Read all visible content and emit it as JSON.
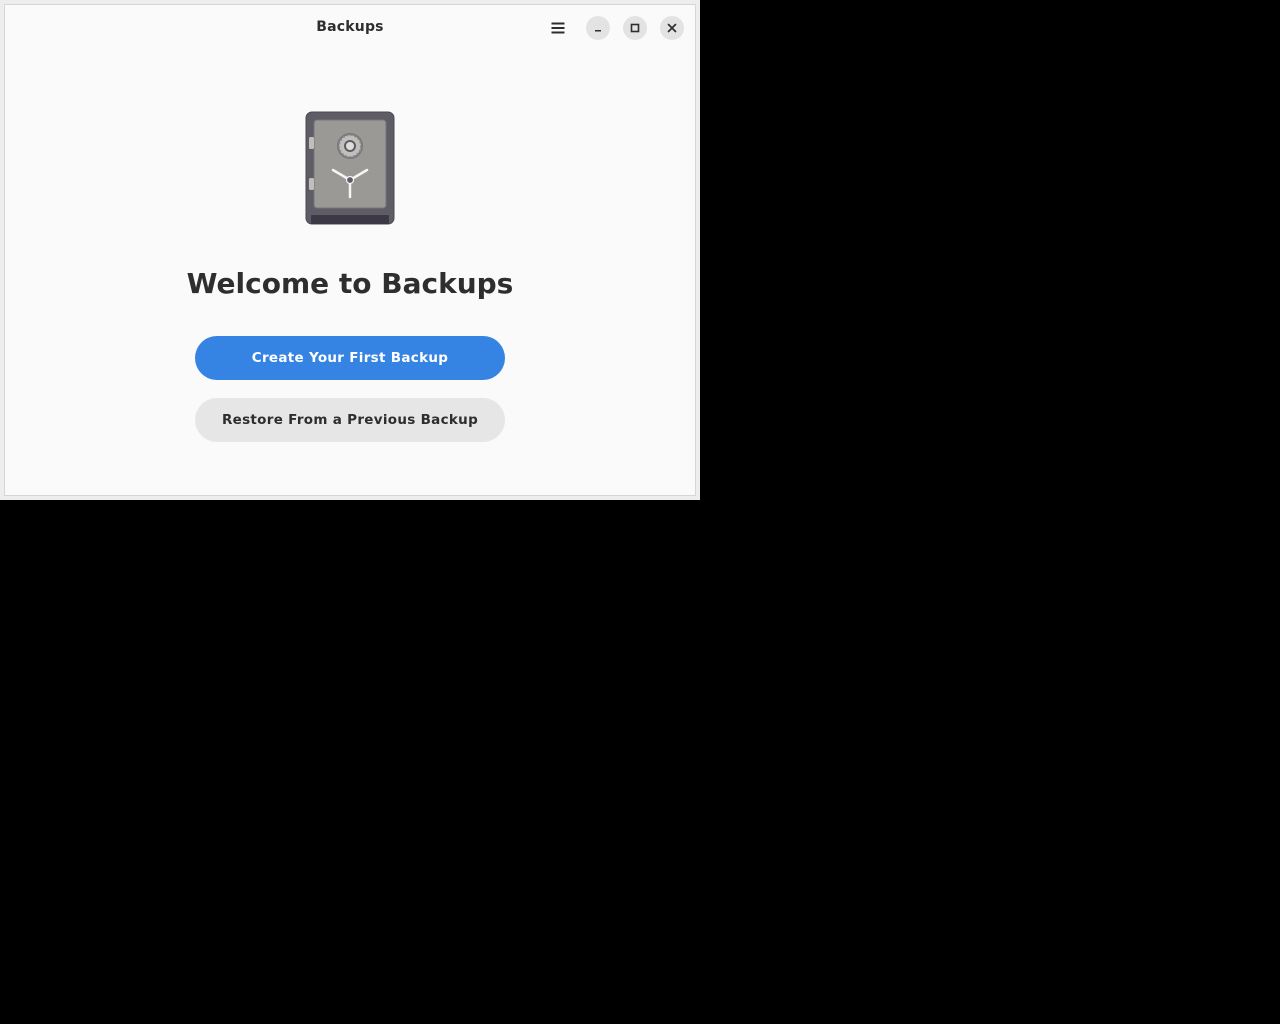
{
  "window": {
    "title": "Backups"
  },
  "header": {
    "menu_icon": "hamburger-menu-icon",
    "minimize_icon": "minimize-icon",
    "maximize_icon": "maximize-icon",
    "close_icon": "close-icon"
  },
  "main": {
    "app_icon": "safe-icon",
    "welcome_title": "Welcome to Backups",
    "create_button_label": "Create Your First Backup",
    "restore_button_label": "Restore From a Previous Backup"
  },
  "colors": {
    "accent": "#3584e4",
    "secondary_button": "#e6e6e6",
    "window_bg": "#fafafa",
    "text": "#2e2e2e"
  }
}
